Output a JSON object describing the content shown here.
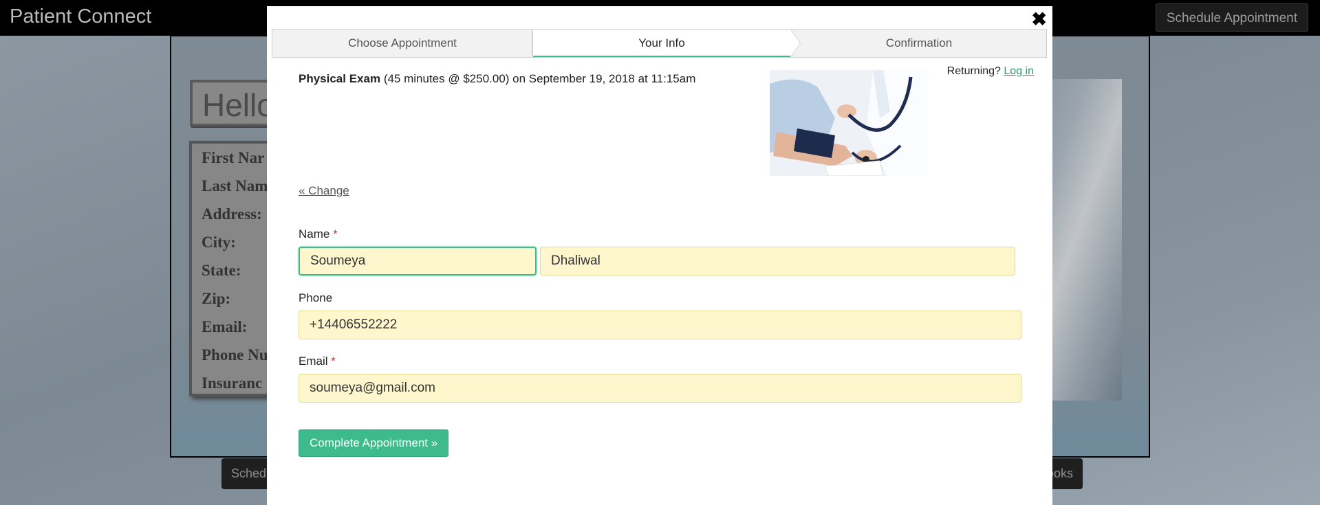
{
  "background": {
    "brand": "Patient Connect",
    "schedule_button": "Schedule Appointment",
    "hello": "Hello",
    "form_labels": [
      "First Nar",
      "Last Nam",
      "Address:",
      "City:",
      "State:",
      "Zip:",
      "Email:",
      "Phone Nu",
      "Insuranc"
    ],
    "bottom_left_button": "Sched",
    "bottom_right_button": "ooks"
  },
  "modal": {
    "close_icon": "close-icon",
    "steps": [
      {
        "label": "Choose Appointment",
        "active": false
      },
      {
        "label": "Your Info",
        "active": true
      },
      {
        "label": "Confirmation",
        "active": false
      }
    ],
    "service_name": "Physical Exam",
    "service_details": "(45 minutes @ $250.00) on September 19, 2018 at 11:15am",
    "returning_text": "Returning?",
    "login_link": "Log in",
    "change_link": "« Change",
    "name_label": "Name",
    "first_name": "Soumeya",
    "last_name": "Dhaliwal",
    "phone_label": "Phone",
    "phone": "+14406552222",
    "email_label": "Email",
    "email": "soumeya@gmail.com",
    "required_marker": "*",
    "submit_label": "Complete Appointment »"
  },
  "colors": {
    "accent": "#3dbb8c",
    "field_bg": "#fef6cc"
  }
}
